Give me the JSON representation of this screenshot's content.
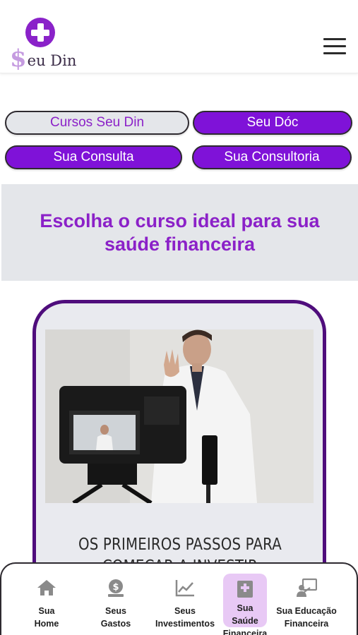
{
  "header": {
    "logo_text": "eu Din",
    "logo_symbol": "$"
  },
  "nav_pills": [
    {
      "label": "Cursos Seu Din",
      "style": "light"
    },
    {
      "label": "Seu Dóc",
      "style": "dark"
    },
    {
      "label": "Sua Consulta",
      "style": "dark"
    },
    {
      "label": "Sua Consultoria",
      "style": "dark"
    }
  ],
  "banner": {
    "title": "Escolha o curso ideal para sua saúde financeira"
  },
  "course_card": {
    "title": "OS PRIMEIROS PASSOS PARA COMEÇAR A INVESTIR"
  },
  "bottom_nav": [
    {
      "label_line1": "Sua",
      "label_line2": "Home",
      "icon": "home-icon"
    },
    {
      "label_line1": "Seus",
      "label_line2": "Gastos",
      "icon": "money-bag-icon"
    },
    {
      "label_line1": "Seus",
      "label_line2": "Investimentos",
      "icon": "chart-icon"
    },
    {
      "label_line1": "Sua",
      "label_line2": "Saúde",
      "label_line3": "Financeira",
      "icon": "medical-book-icon",
      "active": true
    },
    {
      "label_line1": "Sua Educação",
      "label_line2": "Financeira",
      "icon": "teacher-icon"
    }
  ],
  "colors": {
    "brand_purple": "#8b21c8",
    "button_purple": "#7f12d8",
    "card_border": "#4f0d7c",
    "active_nav_bg": "#e8c9f5",
    "banner_bg": "#e4e6ea"
  }
}
